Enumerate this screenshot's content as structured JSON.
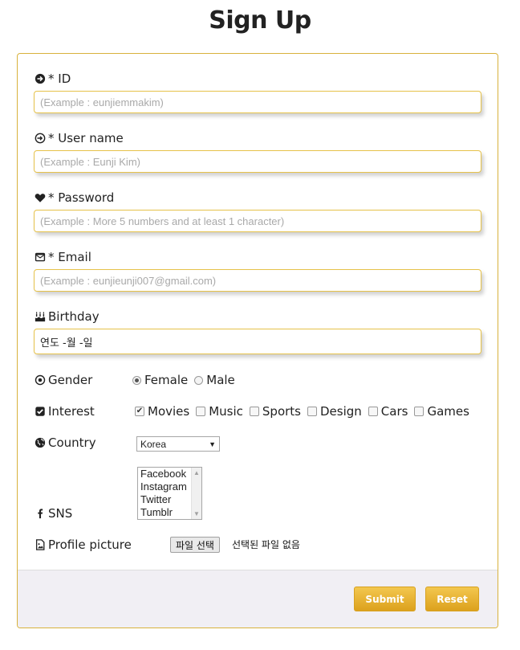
{
  "page": {
    "title": "Sign Up"
  },
  "form": {
    "id": {
      "label": "* ID",
      "placeholder": "(Example : eunjiemmakim)",
      "icon": "circle-arrow-right-icon"
    },
    "username": {
      "label": "* User name",
      "placeholder": "(Example : Eunji Kim)",
      "icon": "circle-arrow-login-icon"
    },
    "password": {
      "label": "* Password",
      "placeholder": "(Example : More 5 numbers and at least 1 character)",
      "icon": "heart-icon"
    },
    "email": {
      "label": "* Email",
      "placeholder": "(Example : eunjieunji007@gmail.com)",
      "icon": "envelope-icon"
    },
    "birthday": {
      "label": "Birthday",
      "value": "연도 -월 -일",
      "icon": "birthday-cake-icon"
    },
    "gender": {
      "label": "Gender",
      "icon": "dot-circle-icon",
      "options": [
        "Female",
        "Male"
      ],
      "selected": "Female"
    },
    "interest": {
      "label": "Interest",
      "icon": "check-square-icon",
      "options": [
        {
          "label": "Movies",
          "checked": true
        },
        {
          "label": "Music",
          "checked": false
        },
        {
          "label": "Sports",
          "checked": false
        },
        {
          "label": "Design",
          "checked": false
        },
        {
          "label": "Cars",
          "checked": false
        },
        {
          "label": "Games",
          "checked": false
        }
      ]
    },
    "country": {
      "label": "Country",
      "icon": "globe-icon",
      "selected": "Korea"
    },
    "sns": {
      "label": "SNS",
      "icon": "facebook-icon",
      "options": [
        "Facebook",
        "Instagram",
        "Twitter",
        "Tumblr"
      ]
    },
    "profile": {
      "label": "Profile picture",
      "icon": "file-image-icon",
      "button": "파일 선택",
      "status": "선택된 파일 없음"
    }
  },
  "actions": {
    "submit": "Submit",
    "reset": "Reset"
  },
  "colors": {
    "accent": "#e6c24a",
    "button": "#dca11d",
    "footer": "#f1eff4"
  }
}
